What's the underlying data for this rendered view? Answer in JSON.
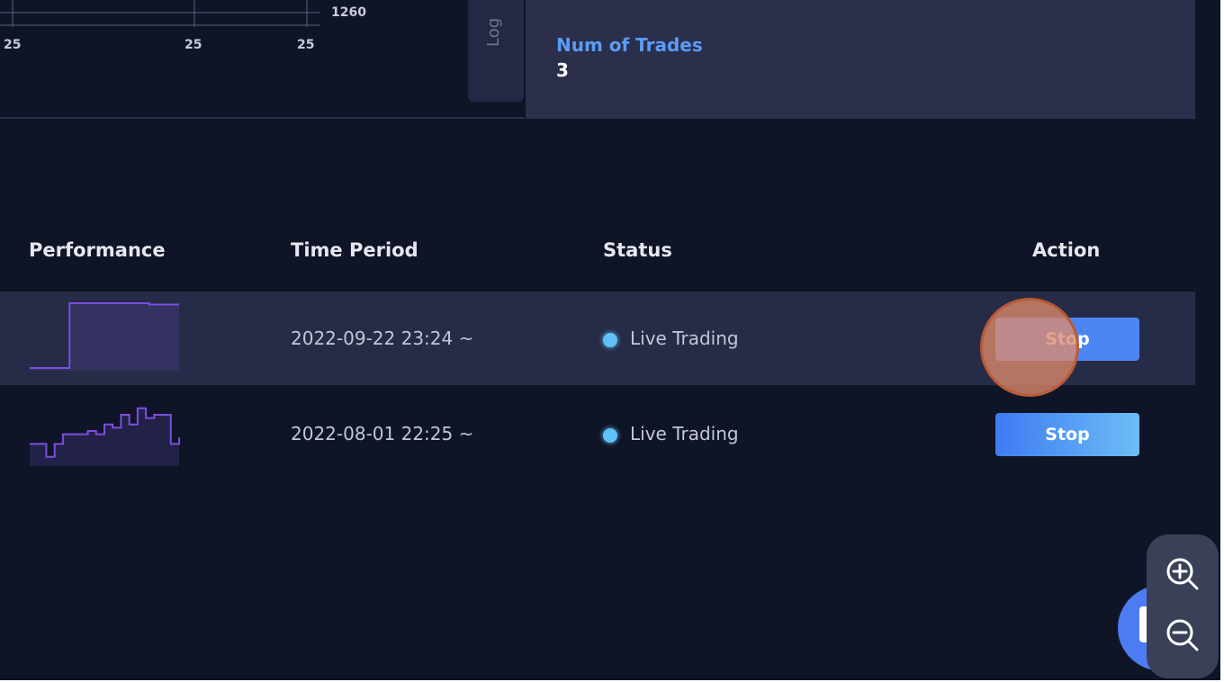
{
  "chart": {
    "y_tick": "1260",
    "x_ticks": [
      "25",
      "25",
      "25"
    ]
  },
  "log_tab": {
    "label": "Log"
  },
  "stats": {
    "num_trades_label": "Num of Trades",
    "num_trades_value": "3"
  },
  "table": {
    "headers": {
      "performance": "Performance",
      "time_period": "Time Period",
      "status": "Status",
      "action": "Action"
    },
    "rows": [
      {
        "time_period": "2022-09-22 23:24 ~",
        "status": "Live Trading",
        "action": "Stop",
        "sparkline": [
          0,
          0,
          0,
          0,
          1,
          1,
          1,
          1,
          1,
          1,
          1,
          1,
          0.98,
          0.98,
          0.98,
          0.98
        ]
      },
      {
        "time_period": "2022-08-01 22:25 ~",
        "status": "Live Trading",
        "action": "Stop",
        "sparkline": [
          0.3,
          0.3,
          0.1,
          0.3,
          0.45,
          0.45,
          0.45,
          0.5,
          0.45,
          0.6,
          0.55,
          0.75,
          0.6,
          0.85,
          0.7,
          0.75,
          0.75,
          0.3,
          0.4
        ]
      }
    ]
  },
  "colors": {
    "background": "#0f1427",
    "panel": "#2b2f4b",
    "accent_blue": "#5a9cf5",
    "status_live": "#5fc1f7",
    "sparkline": "#7b4fe0"
  },
  "icons": {
    "zoom_in": "zoom-in-icon",
    "zoom_out": "zoom-out-icon"
  }
}
